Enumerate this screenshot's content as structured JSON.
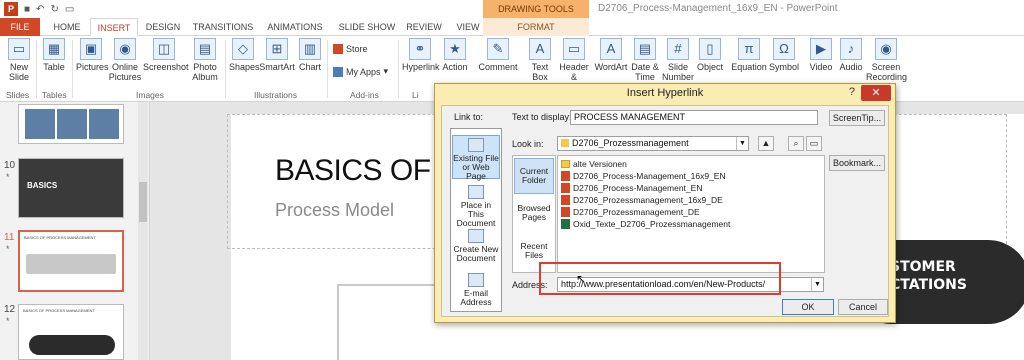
{
  "titlebar": {
    "context_tab": "DRAWING TOOLS",
    "window_title": "D2706_Process-Management_16x9_EN - PowerPoint"
  },
  "tabs": [
    "FILE",
    "HOME",
    "INSERT",
    "DESIGN",
    "TRANSITIONS",
    "ANIMATIONS",
    "SLIDE SHOW",
    "REVIEW",
    "VIEW",
    "FORMAT"
  ],
  "ribbon": {
    "new_slide": "New Slide",
    "table": "Table",
    "pictures": "Pictures",
    "online_pictures": "Online Pictures",
    "screenshot": "Screenshot",
    "photo_album": "Photo Album",
    "shapes": "Shapes",
    "smartart": "SmartArt",
    "chart": "Chart",
    "store": "Store",
    "my_apps": "My Apps",
    "hyperlink": "Hyperlink",
    "action": "Action",
    "comment": "Comment",
    "text_box": "Text Box",
    "header_footer": "Header & Footer",
    "wordart": "WordArt",
    "date_time": "Date & Time",
    "slide_number": "Slide Number",
    "object": "Object",
    "equation": "Equation",
    "symbol": "Symbol",
    "video": "Video",
    "audio": "Audio",
    "screen_recording": "Screen Recording",
    "groups": {
      "slides": "Slides",
      "tables": "Tables",
      "images": "Images",
      "illustrations": "Illustrations",
      "addins": "Add-ins",
      "links": "Li"
    }
  },
  "thumbnails": [
    {
      "num": "10",
      "title": "BASICS"
    },
    {
      "num": "11",
      "title": "BASICS OF PROCESS MANAGEMENT"
    },
    {
      "num": "12",
      "title": "BASICS OF PROCESS MANAGEMENT"
    }
  ],
  "slide": {
    "title": "BASICS OF",
    "subtitle": "Process Model",
    "pill_line1": "STOMER",
    "pill_line2": "CTATIONS"
  },
  "dialog": {
    "title": "Insert Hyperlink",
    "help": "?",
    "close": "✕",
    "link_to_label": "Link to:",
    "link_to": [
      "Existing File or Web Page",
      "Place in This Document",
      "Create New Document",
      "E-mail Address"
    ],
    "text_to_display_label": "Text to display:",
    "text_to_display": "PROCESS MANAGEMENT",
    "screentip": "ScreenTip...",
    "look_in_label": "Look in:",
    "look_in": "D2706_Prozessmanagement",
    "nav": [
      "Current Folder",
      "Browsed Pages",
      "Recent Files"
    ],
    "bookmark": "Bookmark...",
    "files": [
      {
        "name": "alte Versionen",
        "type": "folder"
      },
      {
        "name": "D2706_Process-Management_16x9_EN",
        "type": "ppt"
      },
      {
        "name": "D2706_Process-Management_EN",
        "type": "ppt"
      },
      {
        "name": "D2706_Prozessmanagement_16x9_DE",
        "type": "ppt"
      },
      {
        "name": "D2706_Prozessmanagement_DE",
        "type": "ppt"
      },
      {
        "name": "Oxid_Texte_D2706_Prozessmanagement",
        "type": "xls"
      }
    ],
    "address_label": "Address:",
    "address": "http://www.presentationload.com/en/New-Products/",
    "ok": "OK",
    "cancel": "Cancel"
  }
}
